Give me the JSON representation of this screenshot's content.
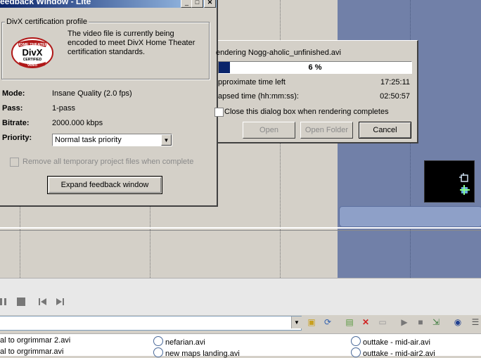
{
  "feedback_window": {
    "title": "eedback Window - Lite",
    "divx_group_label": "DivX certification profile",
    "divx_description": "The video file is currently being encoded to meet DivX Home Theater certification standards.",
    "logo": {
      "top": "HOME THEATER",
      "brand": "DivX",
      "bottom": "CERTIFIED",
      "strip": "VIDEO"
    },
    "mode_label": "Mode:",
    "mode_value": "Insane Quality (2.0 fps)",
    "pass_label": "Pass:",
    "pass_value": "1-pass",
    "bitrate_label": "Bitrate:",
    "bitrate_value": "2000.000 kbps",
    "priority_label": "Priority:",
    "priority_value": "Normal task priority",
    "remove_label": "Remove all temporary project files when complete",
    "expand_button": "Expand feedback window"
  },
  "render_dialog": {
    "title": "endering Nogg-aholic_unfinished.avi",
    "progress_percent": 6,
    "progress_text": "6 %",
    "time_left_label": "pproximate time left",
    "time_left_value": "17:25:11",
    "elapsed_label": "apsed time (hh:mm:ss):",
    "elapsed_value": "02:50:57",
    "close_checkbox_label": "Close this dialog box when rendering completes",
    "open_button": "Open",
    "open_folder_button": "Open Folder",
    "cancel_button": "Cancel"
  },
  "files": [
    {
      "name": "al to orgrimmar 2.avi"
    },
    {
      "name": "al to orgrimmar.avi"
    },
    {
      "name": "nefarian.avi"
    },
    {
      "name": "new maps landing.avi"
    },
    {
      "name": "outtake - mid-air.avi"
    },
    {
      "name": "outtake - mid-air2.avi"
    }
  ]
}
